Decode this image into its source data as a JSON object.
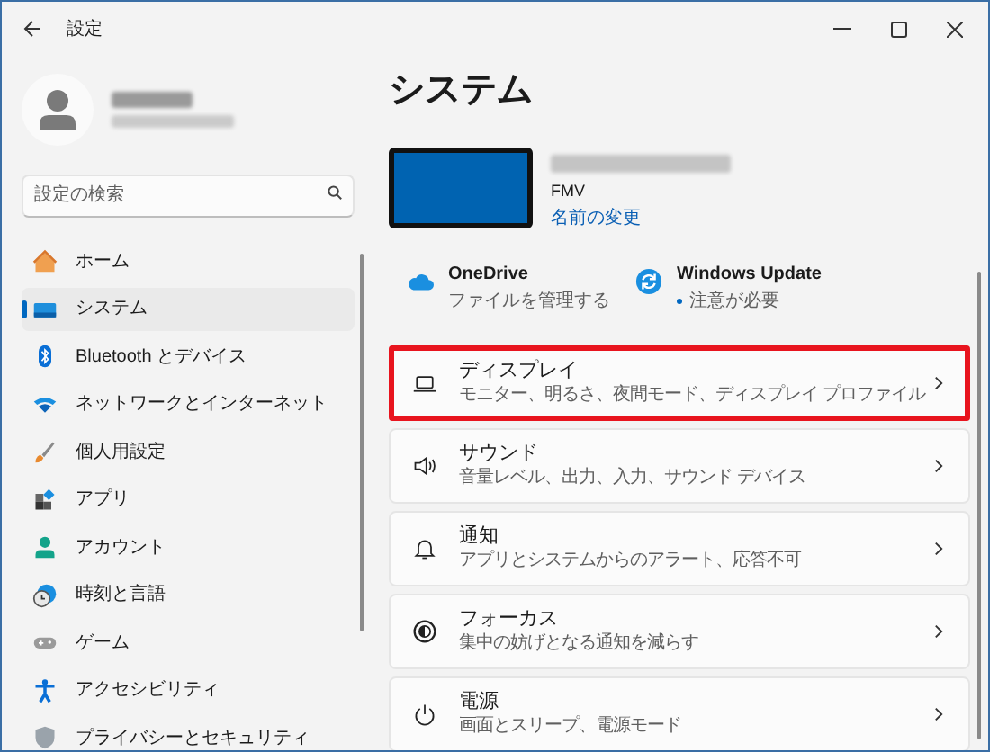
{
  "window": {
    "title": "設定"
  },
  "account": {
    "kind": "blurred"
  },
  "search": {
    "placeholder": "設定の検索"
  },
  "sidebar": {
    "items": [
      {
        "label": "ホーム",
        "selected": false
      },
      {
        "label": "システム",
        "selected": true
      },
      {
        "label": "Bluetooth とデバイス",
        "selected": false
      },
      {
        "label": "ネットワークとインターネット",
        "selected": false
      },
      {
        "label": "個人用設定",
        "selected": false
      },
      {
        "label": "アプリ",
        "selected": false
      },
      {
        "label": "アカウント",
        "selected": false
      },
      {
        "label": "時刻と言語",
        "selected": false
      },
      {
        "label": "ゲーム",
        "selected": false
      },
      {
        "label": "アクセシビリティ",
        "selected": false
      },
      {
        "label": "プライバシーとセキュリティ",
        "selected": false
      }
    ]
  },
  "page": {
    "title": "システム",
    "device": {
      "model": "FMV",
      "rename_link": "名前の変更"
    },
    "status": [
      {
        "title": "OneDrive",
        "subtitle": "ファイルを管理する",
        "alert": false
      },
      {
        "title": "Windows Update",
        "subtitle": "注意が必要",
        "alert": true
      }
    ],
    "cards": [
      {
        "title": "ディスプレイ",
        "subtitle": "モニター、明るさ、夜間モード、ディスプレイ プロファイル",
        "highlighted": true
      },
      {
        "title": "サウンド",
        "subtitle": "音量レベル、出力、入力、サウンド デバイス",
        "highlighted": false
      },
      {
        "title": "通知",
        "subtitle": "アプリとシステムからのアラート、応答不可",
        "highlighted": false
      },
      {
        "title": "フォーカス",
        "subtitle": "集中の妨げとなる通知を減らす",
        "highlighted": false
      },
      {
        "title": "電源",
        "subtitle": "画面とスリープ、電源モード",
        "highlighted": false
      }
    ]
  }
}
